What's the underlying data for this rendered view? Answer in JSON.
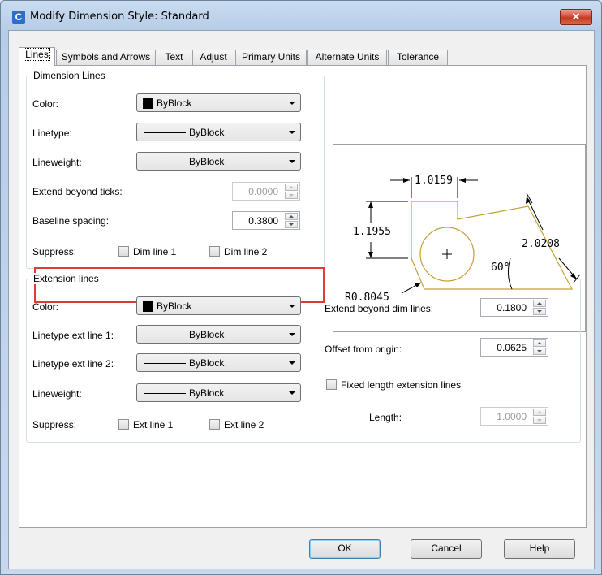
{
  "window": {
    "title": "Modify Dimension Style: Standard",
    "close_glyph": "✕",
    "app_icon_glyph": "C"
  },
  "tabs": [
    {
      "label": "Lines",
      "active": true
    },
    {
      "label": "Symbols and Arrows"
    },
    {
      "label": "Text"
    },
    {
      "label": "Adjust"
    },
    {
      "label": "Primary Units"
    },
    {
      "label": "Alternate Units"
    },
    {
      "label": "Tolerance"
    }
  ],
  "dimension_lines": {
    "title": "Dimension Lines",
    "color_label": "Color:",
    "color_value": "ByBlock",
    "linetype_label": "Linetype:",
    "linetype_value": "ByBlock",
    "lineweight_label": "Lineweight:",
    "lineweight_value": "ByBlock",
    "extend_label": "Extend beyond ticks:",
    "extend_value": "0.0000",
    "baseline_label": "Baseline spacing:",
    "baseline_value": "0.3800",
    "suppress_label": "Suppress:",
    "dim_line1": "Dim line 1",
    "dim_line2": "Dim line 2"
  },
  "extension_lines": {
    "title": "Extension lines",
    "color_label": "Color:",
    "color_value": "ByBlock",
    "linetype1_label": "Linetype ext line 1:",
    "linetype1_value": "ByBlock",
    "linetype2_label": "Linetype ext line 2:",
    "linetype2_value": "ByBlock",
    "lineweight_label": "Lineweight:",
    "lineweight_value": "ByBlock",
    "suppress_label": "Suppress:",
    "ext_line1": "Ext line 1",
    "ext_line2": "Ext line 2",
    "extend_dim_label": "Extend beyond dim lines:",
    "extend_dim_value": "0.1800",
    "offset_label": "Offset from origin:",
    "offset_value": "0.0625",
    "fixed_label": "Fixed length extension lines",
    "length_label": "Length:",
    "length_value": "1.0000"
  },
  "preview": {
    "dim_top": "1.0159",
    "dim_left": "1.1955",
    "dim_right": "2.0208",
    "angle": "60°",
    "radius": "R0.8045"
  },
  "buttons": {
    "ok": "OK",
    "cancel": "Cancel",
    "help": "Help"
  },
  "colors": {
    "highlight": "#e03a3a",
    "shape_stroke": "#c8a030",
    "preview_text": "#000000"
  }
}
